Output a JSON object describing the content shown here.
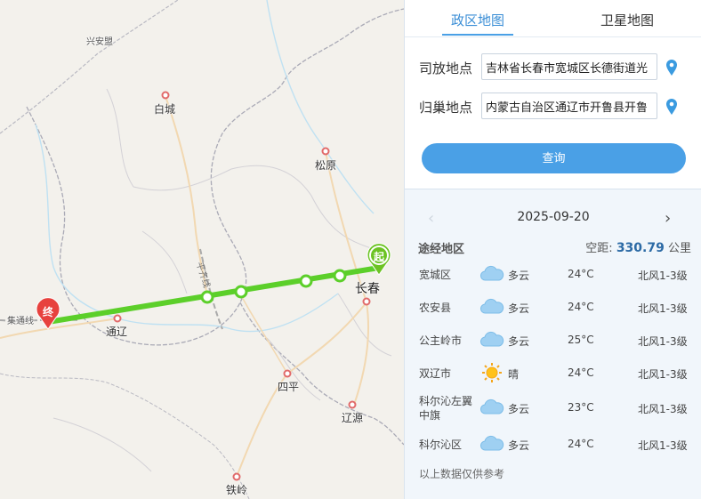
{
  "map": {
    "cities": {
      "xinganmeng": "兴安盟",
      "baicheng": "白城",
      "songyuan": "松原",
      "changchun": "长春",
      "tongliao": "通辽",
      "siping": "四平",
      "liaoyuan": "辽源",
      "tieling": "铁岭"
    },
    "rail_labels": {
      "pingqi": "平齐线",
      "jitong": "集通线"
    },
    "markers": {
      "start": "起",
      "end": "终"
    },
    "colors": {
      "route": "#5ccf2a",
      "start_marker": "#6cc323",
      "end_marker": "#e7423e"
    }
  },
  "panel": {
    "tabs": {
      "admin": "政区地图",
      "satellite": "卫星地图"
    },
    "release": {
      "label": "司放地点",
      "value": "吉林省长春市宽城区长德街道光"
    },
    "home": {
      "label": "归巢地点",
      "value": "内蒙古自治区通辽市开鲁县开鲁"
    },
    "query_button": "查询",
    "date": "2025-09-20",
    "nav_prev": "‹",
    "nav_next": "›",
    "route_title": "途经地区",
    "distance_label": "空距:",
    "distance_value": "330.79",
    "distance_unit": "公里",
    "weather": [
      {
        "area": "宽城区",
        "icon": "cloudy-icon",
        "desc": "多云",
        "temp": "24°C",
        "wind": "北风1-3级"
      },
      {
        "area": "农安县",
        "icon": "cloudy-icon",
        "desc": "多云",
        "temp": "24°C",
        "wind": "北风1-3级"
      },
      {
        "area": "公主岭市",
        "icon": "cloudy-icon",
        "desc": "多云",
        "temp": "25°C",
        "wind": "北风1-3级"
      },
      {
        "area": "双辽市",
        "icon": "sunny-icon",
        "desc": "晴",
        "temp": "24°C",
        "wind": "北风1-3级"
      },
      {
        "area": "科尔沁左翼中旗",
        "icon": "cloudy-icon",
        "desc": "多云",
        "temp": "23°C",
        "wind": "北风1-3级"
      },
      {
        "area": "科尔沁区",
        "icon": "cloudy-icon",
        "desc": "多云",
        "temp": "24°C",
        "wind": "北风1-3级"
      }
    ],
    "footnote": "以上数据仅供参考"
  }
}
